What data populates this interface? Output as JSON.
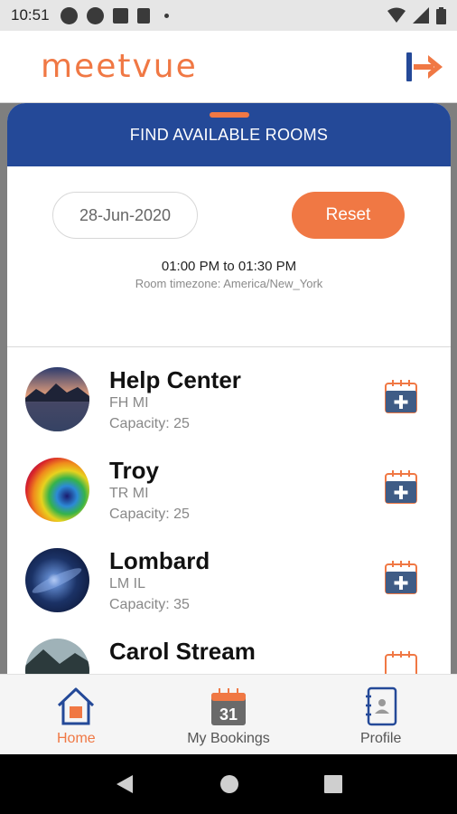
{
  "status_bar": {
    "time": "10:51"
  },
  "app": {
    "logo": "meetvue"
  },
  "sheet": {
    "title": "FIND AVAILABLE ROOMS",
    "date": "28-Jun-2020",
    "reset_label": "Reset",
    "time_range": "01:00 PM to 01:30 PM",
    "timezone": "Room timezone: America/New_York"
  },
  "rooms": [
    {
      "name": "Help Center",
      "code": "FH MI",
      "capacity": "Capacity: 25"
    },
    {
      "name": "Troy",
      "code": "TR MI",
      "capacity": "Capacity: 25"
    },
    {
      "name": "Lombard",
      "code": "LM IL",
      "capacity": "Capacity: 35"
    },
    {
      "name": "Carol Stream",
      "code": "",
      "capacity": ""
    }
  ],
  "calendar_icon_day": "31",
  "nav": {
    "home": "Home",
    "bookings": "My Bookings",
    "profile": "Profile"
  },
  "colors": {
    "accent": "#f07844",
    "header_blue": "#244998",
    "icon_blue": "#244998"
  }
}
